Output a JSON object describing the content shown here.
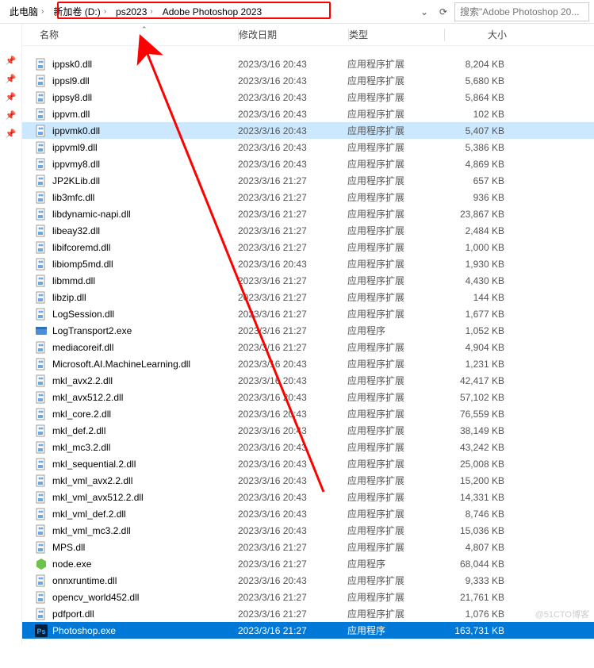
{
  "breadcrumb": {
    "root": "此电脑",
    "parts": [
      "新加卷 (D:)",
      "ps2023",
      "Adobe Photoshop 2023"
    ]
  },
  "search": {
    "placeholder": "搜索\"Adobe Photoshop 20..."
  },
  "columns": {
    "name": "名称",
    "date": "修改日期",
    "type": "类型",
    "size": "大小"
  },
  "type_labels": {
    "ext": "应用程序扩展",
    "app": "应用程序"
  },
  "files": [
    {
      "name": "ippsk0.dll",
      "date": "2023/3/16 20:43",
      "type": "ext",
      "size": "8,204 KB",
      "icon": "dll"
    },
    {
      "name": "ippsl9.dll",
      "date": "2023/3/16 20:43",
      "type": "ext",
      "size": "5,680 KB",
      "icon": "dll"
    },
    {
      "name": "ippsy8.dll",
      "date": "2023/3/16 20:43",
      "type": "ext",
      "size": "5,864 KB",
      "icon": "dll"
    },
    {
      "name": "ippvm.dll",
      "date": "2023/3/16 20:43",
      "type": "ext",
      "size": "102 KB",
      "icon": "dll"
    },
    {
      "name": "ippvmk0.dll",
      "date": "2023/3/16 20:43",
      "type": "ext",
      "size": "5,407 KB",
      "icon": "dll",
      "sel": "light"
    },
    {
      "name": "ippvml9.dll",
      "date": "2023/3/16 20:43",
      "type": "ext",
      "size": "5,386 KB",
      "icon": "dll"
    },
    {
      "name": "ippvmy8.dll",
      "date": "2023/3/16 20:43",
      "type": "ext",
      "size": "4,869 KB",
      "icon": "dll"
    },
    {
      "name": "JP2KLib.dll",
      "date": "2023/3/16 21:27",
      "type": "ext",
      "size": "657 KB",
      "icon": "dll"
    },
    {
      "name": "lib3mfc.dll",
      "date": "2023/3/16 21:27",
      "type": "ext",
      "size": "936 KB",
      "icon": "dll"
    },
    {
      "name": "libdynamic-napi.dll",
      "date": "2023/3/16 21:27",
      "type": "ext",
      "size": "23,867 KB",
      "icon": "dll"
    },
    {
      "name": "libeay32.dll",
      "date": "2023/3/16 21:27",
      "type": "ext",
      "size": "2,484 KB",
      "icon": "dll"
    },
    {
      "name": "libifcoremd.dll",
      "date": "2023/3/16 21:27",
      "type": "ext",
      "size": "1,000 KB",
      "icon": "dll"
    },
    {
      "name": "libiomp5md.dll",
      "date": "2023/3/16 20:43",
      "type": "ext",
      "size": "1,930 KB",
      "icon": "dll"
    },
    {
      "name": "libmmd.dll",
      "date": "2023/3/16 21:27",
      "type": "ext",
      "size": "4,430 KB",
      "icon": "dll"
    },
    {
      "name": "libzip.dll",
      "date": "2023/3/16 21:27",
      "type": "ext",
      "size": "144 KB",
      "icon": "dll"
    },
    {
      "name": "LogSession.dll",
      "date": "2023/3/16 21:27",
      "type": "ext",
      "size": "1,677 KB",
      "icon": "dll"
    },
    {
      "name": "LogTransport2.exe",
      "date": "2023/3/16 21:27",
      "type": "app",
      "size": "1,052 KB",
      "icon": "exe"
    },
    {
      "name": "mediacoreif.dll",
      "date": "2023/3/16 21:27",
      "type": "ext",
      "size": "4,904 KB",
      "icon": "dll"
    },
    {
      "name": "Microsoft.AI.MachineLearning.dll",
      "date": "2023/3/16 20:43",
      "type": "ext",
      "size": "1,231 KB",
      "icon": "dll"
    },
    {
      "name": "mkl_avx2.2.dll",
      "date": "2023/3/16 20:43",
      "type": "ext",
      "size": "42,417 KB",
      "icon": "dll"
    },
    {
      "name": "mkl_avx512.2.dll",
      "date": "2023/3/16 20:43",
      "type": "ext",
      "size": "57,102 KB",
      "icon": "dll"
    },
    {
      "name": "mkl_core.2.dll",
      "date": "2023/3/16 20:43",
      "type": "ext",
      "size": "76,559 KB",
      "icon": "dll"
    },
    {
      "name": "mkl_def.2.dll",
      "date": "2023/3/16 20:43",
      "type": "ext",
      "size": "38,149 KB",
      "icon": "dll"
    },
    {
      "name": "mkl_mc3.2.dll",
      "date": "2023/3/16 20:43",
      "type": "ext",
      "size": "43,242 KB",
      "icon": "dll"
    },
    {
      "name": "mkl_sequential.2.dll",
      "date": "2023/3/16 20:43",
      "type": "ext",
      "size": "25,008 KB",
      "icon": "dll"
    },
    {
      "name": "mkl_vml_avx2.2.dll",
      "date": "2023/3/16 20:43",
      "type": "ext",
      "size": "15,200 KB",
      "icon": "dll"
    },
    {
      "name": "mkl_vml_avx512.2.dll",
      "date": "2023/3/16 20:43",
      "type": "ext",
      "size": "14,331 KB",
      "icon": "dll"
    },
    {
      "name": "mkl_vml_def.2.dll",
      "date": "2023/3/16 20:43",
      "type": "ext",
      "size": "8,746 KB",
      "icon": "dll"
    },
    {
      "name": "mkl_vml_mc3.2.dll",
      "date": "2023/3/16 20:43",
      "type": "ext",
      "size": "15,036 KB",
      "icon": "dll"
    },
    {
      "name": "MPS.dll",
      "date": "2023/3/16 21:27",
      "type": "ext",
      "size": "4,807 KB",
      "icon": "dll"
    },
    {
      "name": "node.exe",
      "date": "2023/3/16 21:27",
      "type": "app",
      "size": "68,044 KB",
      "icon": "node"
    },
    {
      "name": "onnxruntime.dll",
      "date": "2023/3/16 20:43",
      "type": "ext",
      "size": "9,333 KB",
      "icon": "dll"
    },
    {
      "name": "opencv_world452.dll",
      "date": "2023/3/16 21:27",
      "type": "ext",
      "size": "21,761 KB",
      "icon": "dll"
    },
    {
      "name": "pdfport.dll",
      "date": "2023/3/16 21:27",
      "type": "ext",
      "size": "1,076 KB",
      "icon": "dll"
    },
    {
      "name": "Photoshop.exe",
      "date": "2023/3/16 21:27",
      "type": "app",
      "size": "163,731 KB",
      "icon": "ps",
      "sel": "dark"
    }
  ],
  "truncated_first": {
    "date": "",
    "size": ""
  },
  "watermark": "@51CTO博客"
}
